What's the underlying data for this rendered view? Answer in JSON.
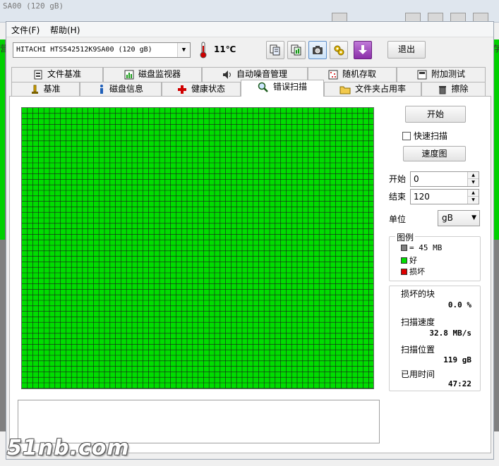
{
  "background": {
    "title": "SA00 (120 gB)",
    "left_edge_text": "营",
    "right_edge_text": "存"
  },
  "menu": {
    "file": "文件(F)",
    "help": "帮助(H)"
  },
  "toolbar": {
    "drive": "HITACHI HTS542512K9SA00 (120 gB)",
    "temperature": "11℃",
    "exit": "退出",
    "icons": [
      "copy-info-icon",
      "copy-report-icon",
      "screenshot-camera-icon",
      "settings-icon",
      "download-icon"
    ]
  },
  "tabs_top": [
    {
      "label": "文件基准",
      "icon": "file-benchmark-icon"
    },
    {
      "label": "磁盘监视器",
      "icon": "disk-monitor-icon"
    },
    {
      "label": "自动噪音管理",
      "icon": "speaker-icon"
    },
    {
      "label": "随机存取",
      "icon": "random-access-icon"
    },
    {
      "label": "附加测试",
      "icon": "extra-tests-icon"
    }
  ],
  "tabs_bottom": [
    {
      "label": "基准",
      "icon": "benchmark-icon"
    },
    {
      "label": "磁盘信息",
      "icon": "info-icon"
    },
    {
      "label": "健康状态",
      "icon": "health-cross-icon"
    },
    {
      "label": "错误扫描",
      "icon": "magnifier-icon",
      "active": true
    },
    {
      "label": "文件夹占用率",
      "icon": "folder-icon"
    },
    {
      "label": "擦除",
      "icon": "trash-icon"
    }
  ],
  "scan": {
    "start_button": "开始",
    "quick_scan": "快速扫描",
    "quick_scan_checked": false,
    "speed_map_button": "速度图",
    "start_label": "开始",
    "start_value": "0",
    "end_label": "结束",
    "end_value": "120",
    "unit_label": "单位",
    "unit_value": "gB"
  },
  "legend": {
    "title": "图例",
    "block_size": "= 45 MB",
    "good": "好",
    "bad": "损坏",
    "colors": {
      "block": "#808080",
      "good": "#00dd00",
      "bad": "#dd0000"
    }
  },
  "stats": {
    "bad_blocks_label": "损坏的块",
    "bad_blocks_value": "0.0 %",
    "scan_speed_label": "扫描速度",
    "scan_speed_value": "32.8 MB/s",
    "scan_position_label": "扫描位置",
    "scan_position_value": "119 gB",
    "elapsed_label": "已用时间",
    "elapsed_value": "47:22"
  },
  "grid": {
    "color": "#00dd00",
    "line_color": "#1a1a1a"
  },
  "watermark": "51nb.com"
}
